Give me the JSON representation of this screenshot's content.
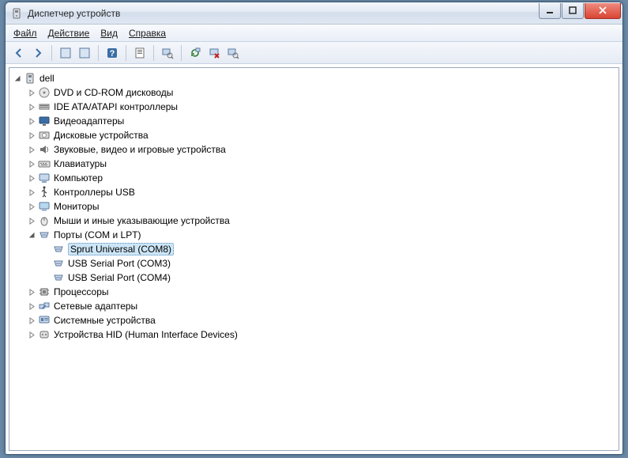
{
  "window": {
    "title": "Диспетчер устройств"
  },
  "menu": {
    "file": "Файл",
    "action": "Действие",
    "view": "Вид",
    "help": "Справка"
  },
  "tree": {
    "root": "dell",
    "items": [
      {
        "label": "DVD и CD-ROM дисководы",
        "icon": "disc"
      },
      {
        "label": "IDE ATA/ATAPI контроллеры",
        "icon": "ide"
      },
      {
        "label": "Видеоадаптеры",
        "icon": "display"
      },
      {
        "label": "Дисковые устройства",
        "icon": "disk"
      },
      {
        "label": "Звуковые, видео и игровые устройства",
        "icon": "sound"
      },
      {
        "label": "Клавиатуры",
        "icon": "keyboard"
      },
      {
        "label": "Компьютер",
        "icon": "computer"
      },
      {
        "label": "Контроллеры USB",
        "icon": "usb"
      },
      {
        "label": "Мониторы",
        "icon": "monitor"
      },
      {
        "label": "Мыши и иные указывающие устройства",
        "icon": "mouse"
      },
      {
        "label": "Порты (COM и LPT)",
        "icon": "port",
        "expanded": true,
        "children": [
          {
            "label": "Sprut Universal (COM8)",
            "icon": "port",
            "selected": true
          },
          {
            "label": "USB Serial Port (COM3)",
            "icon": "port"
          },
          {
            "label": "USB Serial Port (COM4)",
            "icon": "port"
          }
        ]
      },
      {
        "label": "Процессоры",
        "icon": "cpu"
      },
      {
        "label": "Сетевые адаптеры",
        "icon": "network"
      },
      {
        "label": "Системные устройства",
        "icon": "system"
      },
      {
        "label": "Устройства HID (Human Interface Devices)",
        "icon": "hid"
      }
    ]
  }
}
